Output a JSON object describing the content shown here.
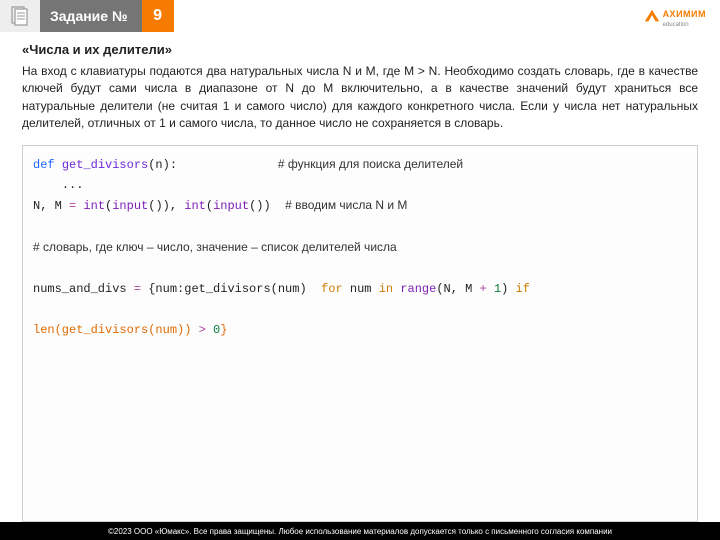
{
  "header": {
    "title": "Задание №",
    "number": "9",
    "logo": {
      "brand": "АХИМИМ",
      "sub": "education"
    }
  },
  "subtitle": "«Числа и их делители»",
  "paragraph": "На вход с клавиатуры подаются два натуральных числа N и M, где M > N. Необходимо создать словарь, где в качестве ключей будут сами числа в диапазоне от N до M включительно, а в качестве значений будут храниться все натуральные делители (не считая 1 и самого число) для каждого конкретного числа. Если у числа нет натуральных делителей, отличных от 1 и самого числа, то данное число не сохраняется в словарь.",
  "code": {
    "l1_def": "def",
    "l1_fn": "get_divisors",
    "l1_rest": "(n):",
    "l1_comment": "# функция для поиска делителей",
    "l2": "    ...",
    "l3_a": "N, M ",
    "l3_eq": "=",
    "l3_b": " int",
    "l3_c": "(",
    "l3_inp": "input",
    "l3_d": "()), ",
    "l3_e": "int",
    "l3_f": "(",
    "l3_g": "input",
    "l3_h": "()) ",
    "l3_comment": "# вводим числа N и M",
    "l4_comment": "# словарь, где ключ – число, значение – список делителей числа",
    "l5_a": "nums_and_divs ",
    "l5_eq": "=",
    "l5_b": " {num:get_divisors(num)  ",
    "l5_for": "for",
    "l5_c": " num ",
    "l5_in": "in",
    "l5_d": " ",
    "l5_range": "range",
    "l5_e": "(N, M ",
    "l5_plus": "+",
    "l5_f": " ",
    "l5_one": "1",
    "l5_g": ") ",
    "l5_if": "if",
    "l6_a": "len",
    "l6_b": "(get_divisors(num)) ",
    "l6_gt": ">",
    "l6_c": " ",
    "l6_zero": "0",
    "l6_d": "}"
  },
  "footer": "©2023 ООО «Юмакс». Все права защищены. Любое использование материалов допускается только с письменного согласия компании"
}
